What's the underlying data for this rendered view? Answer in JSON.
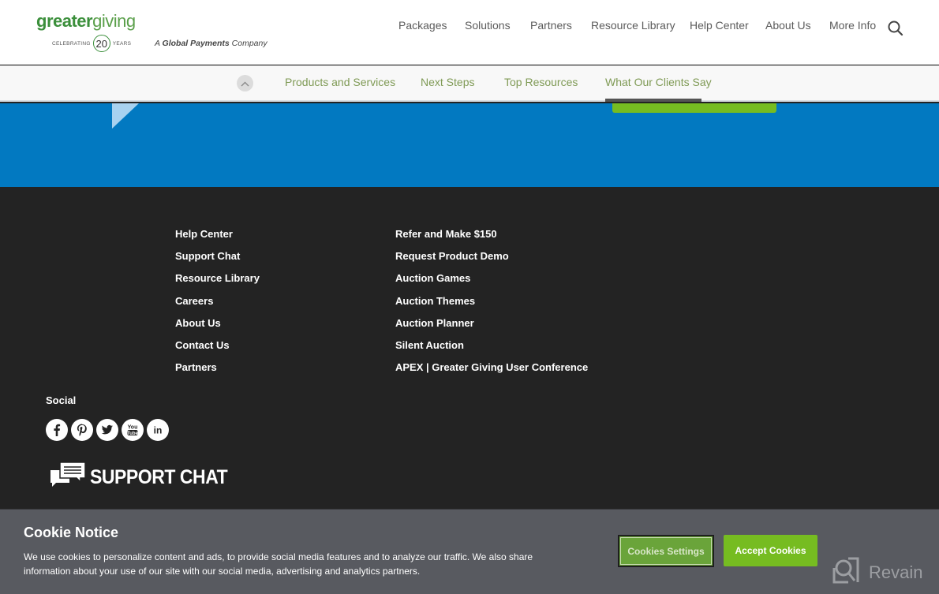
{
  "header": {
    "logo": {
      "word_bold": "greater",
      "word_light": "giving",
      "celebrating": "CELEBRATING",
      "years_number": "20",
      "years": "YEARS"
    },
    "tagline": {
      "prefix": "A ",
      "brand": "Global Payments",
      "suffix": " Company"
    },
    "nav": [
      {
        "label": "Packages"
      },
      {
        "label": "Solutions"
      },
      {
        "label": "Partners"
      },
      {
        "label": "Resource Library"
      },
      {
        "label": "Help Center"
      },
      {
        "label": "About Us"
      },
      {
        "label": "More Info"
      }
    ],
    "search_icon": "search-icon"
  },
  "subnav": {
    "items": [
      {
        "label": "Products and Services"
      },
      {
        "label": "Next Steps"
      },
      {
        "label": "Top Resources"
      },
      {
        "label": "What Our Clients Say",
        "active": true
      }
    ],
    "active_index": 3
  },
  "footer": {
    "col1": [
      {
        "label": "Help Center"
      },
      {
        "label": "Support Chat"
      },
      {
        "label": "Resource Library"
      },
      {
        "label": "Careers"
      },
      {
        "label": "About Us"
      },
      {
        "label": "Contact Us"
      },
      {
        "label": "Partners"
      }
    ],
    "col2": [
      {
        "label": "Refer and Make $150"
      },
      {
        "label": "Request Product Demo"
      },
      {
        "label": "Auction Games"
      },
      {
        "label": "Auction Themes"
      },
      {
        "label": "Auction Planner"
      },
      {
        "label": "Silent Auction"
      },
      {
        "label": "APEX | Greater Giving User Conference"
      }
    ],
    "social_label": "Social",
    "social": [
      {
        "name": "facebook",
        "glyph": "f"
      },
      {
        "name": "pinterest",
        "glyph": "P"
      },
      {
        "name": "twitter",
        "glyph": "t"
      },
      {
        "name": "youtube",
        "glyph": "You Tube"
      },
      {
        "name": "linkedin",
        "glyph": "in"
      }
    ],
    "support_chat": "SUPPORT CHAT"
  },
  "cookie": {
    "title": "Cookie Notice",
    "text": "We use cookies to personalize content and ads, to provide social media features and to analyze our traffic. We also share information about your use of our site with our social media, advertising and analytics partners.",
    "settings_label": "Cookies Settings",
    "accept_label": "Accept Cookies"
  },
  "watermark": "Revain",
  "colors": {
    "brand_green": "#76bc21",
    "blue_band": "#0279c1",
    "footer_bg": "#232323",
    "cookie_bg": "#585a60",
    "subnav_text": "#7f9a55"
  }
}
